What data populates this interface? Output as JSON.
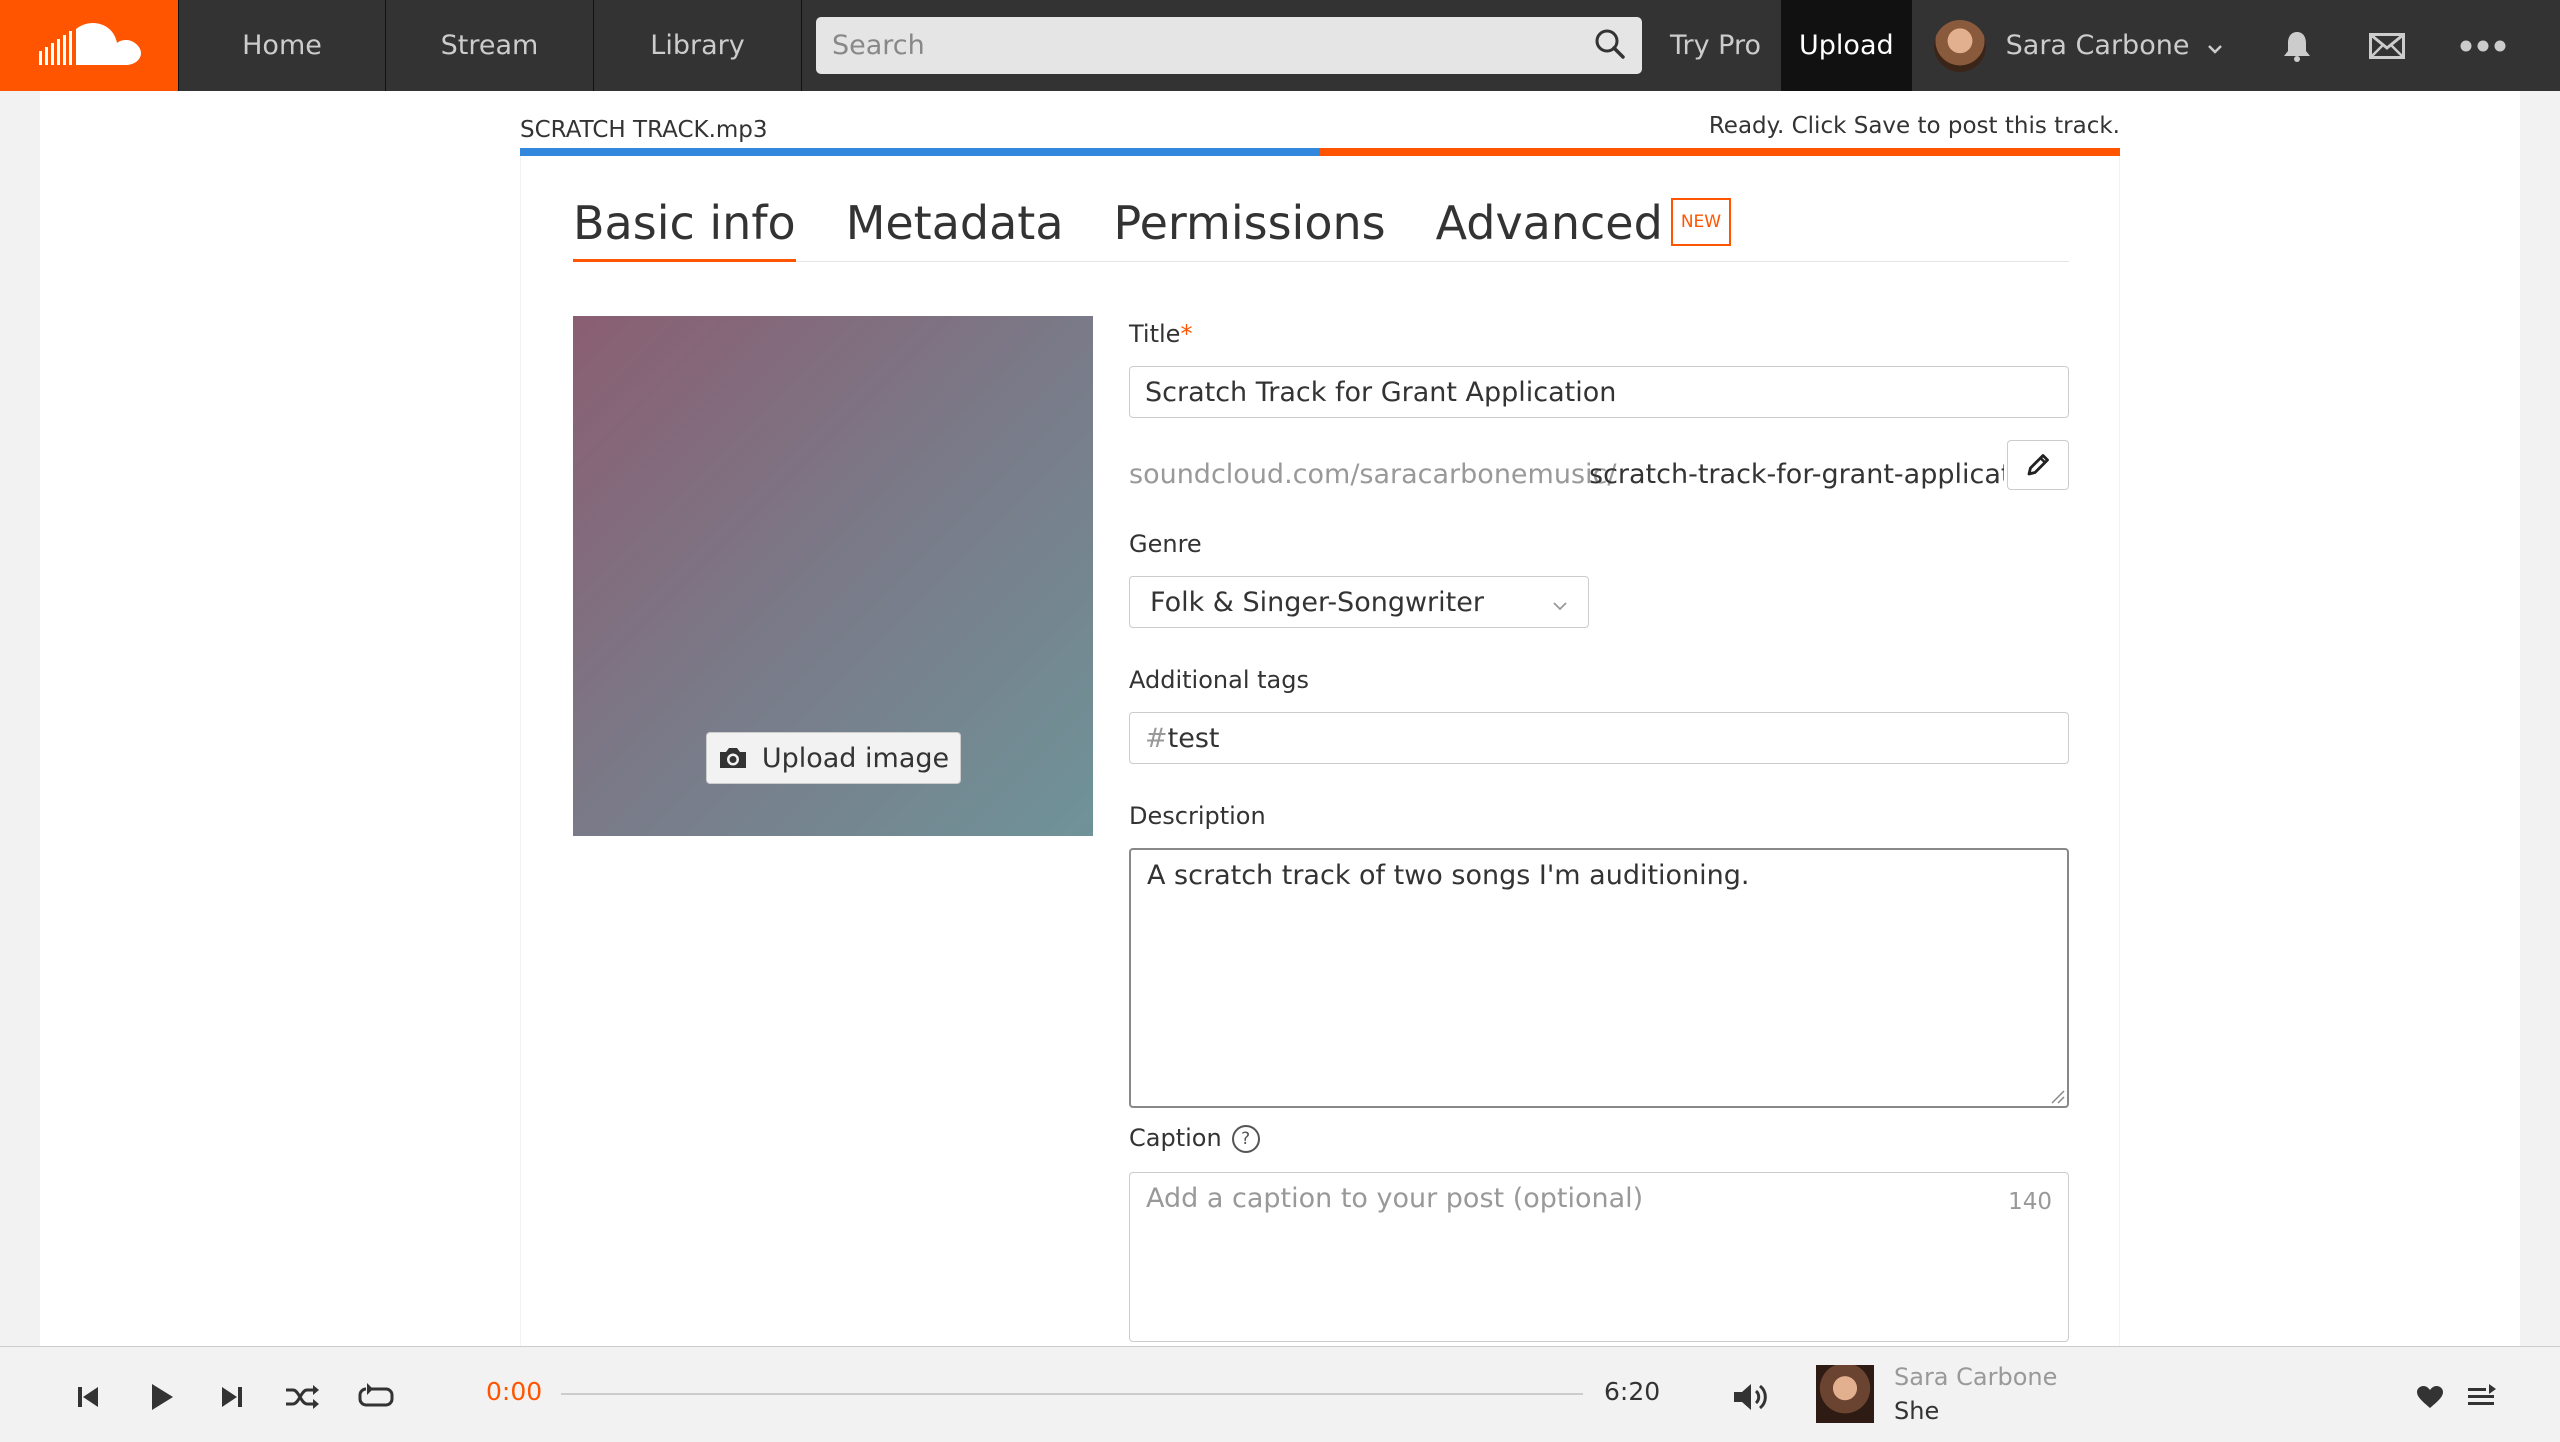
{
  "header": {
    "nav": {
      "home": "Home",
      "stream": "Stream",
      "library": "Library"
    },
    "search_placeholder": "Search",
    "try_pro": "Try Pro",
    "upload": "Upload",
    "user_name": "Sara Carbone"
  },
  "upload": {
    "filename": "SCRATCH TRACK.mp3",
    "status": "Ready. Click Save to post this track.",
    "progress_fraction": 0.5
  },
  "tabs": {
    "basic_info": "Basic info",
    "metadata": "Metadata",
    "permissions": "Permissions",
    "advanced": "Advanced",
    "new_badge": "NEW"
  },
  "artwork": {
    "upload_image_label": "Upload image"
  },
  "form": {
    "title_label": "Title",
    "title_required_mark": "*",
    "title_value": "Scratch Track for Grant Application",
    "url_prefix": "soundcloud.com/saracarbonemusic/",
    "url_slug": "scratch-track-for-grant-application",
    "genre_label": "Genre",
    "genre_value": "Folk & Singer-Songwriter",
    "tags_label": "Additional tags",
    "tag_hash": "#",
    "tag_value": "test",
    "description_label": "Description",
    "description_value": "A scratch track of two songs I'm auditioning.",
    "caption_label": "Caption",
    "caption_help": "?",
    "caption_placeholder": "Add a caption to your post (optional)",
    "caption_counter": "140"
  },
  "player": {
    "current_time": "0:00",
    "total_time": "6:20",
    "progress_fraction": 0,
    "artist": "Sara Carbone",
    "title": "She"
  },
  "colors": {
    "accent": "#ff5500",
    "progress_blue": "#3388dd",
    "header_bg": "#333333"
  }
}
